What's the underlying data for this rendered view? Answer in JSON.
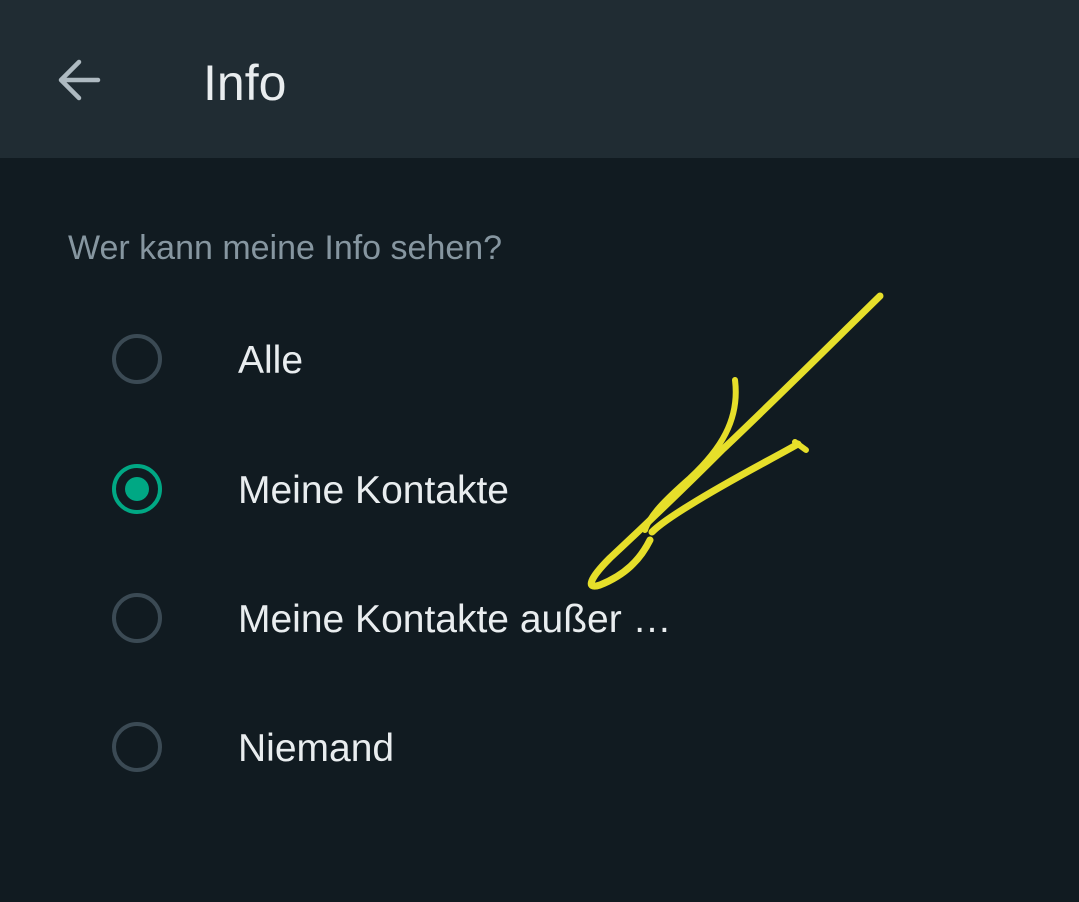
{
  "header": {
    "title": "Info",
    "back_icon": "arrow-left-icon"
  },
  "section": {
    "label": "Wer kann meine Info sehen?"
  },
  "options": [
    {
      "label": "Alle",
      "selected": false
    },
    {
      "label": "Meine Kontakte",
      "selected": true
    },
    {
      "label": "Meine Kontakte außer …",
      "selected": false
    },
    {
      "label": "Niemand",
      "selected": false
    }
  ],
  "colors": {
    "appbar_background": "#202c33",
    "page_background": "#111b21",
    "accent": "#00a884",
    "primary_text": "#e9edef",
    "secondary_text": "#8696a0",
    "radio_unselected": "#3b4a54",
    "annotation_stroke": "#e6df2a"
  },
  "annotation": {
    "type": "hand-drawn-arrow",
    "color": "#e6df2a",
    "points_to": "Meine Kontakte außer …"
  }
}
